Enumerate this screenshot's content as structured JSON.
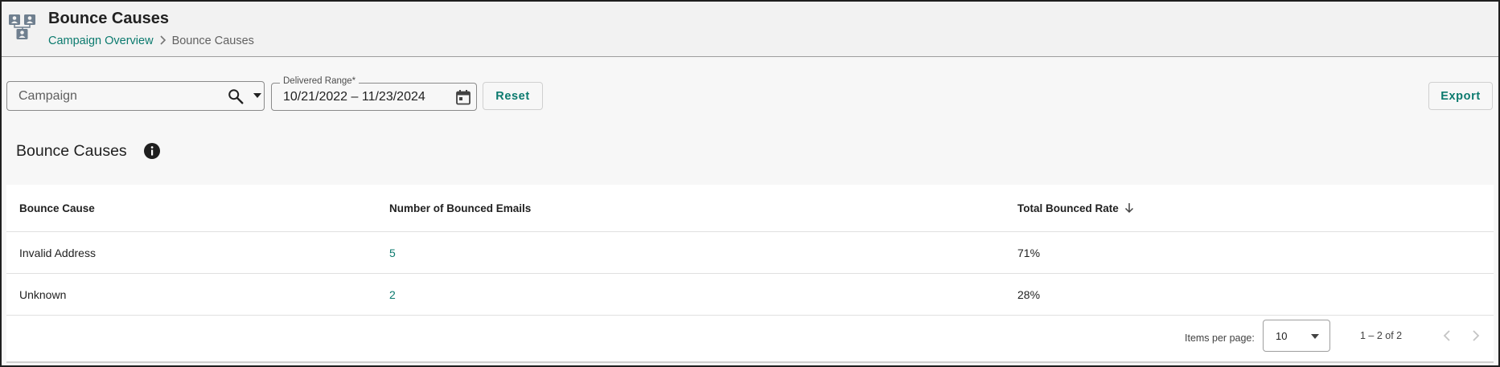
{
  "header": {
    "title": "Bounce Causes",
    "icon": "contacts-group-icon",
    "breadcrumb": {
      "link_label": "Campaign Overview",
      "separator": ">",
      "current": "Bounce Causes"
    }
  },
  "filters": {
    "campaign": {
      "placeholder": "Campaign",
      "value": ""
    },
    "delivered_range": {
      "label": "Delivered Range*",
      "value": "10/21/2022 – 11/23/2024"
    },
    "reset_label": "Reset",
    "export_label": "Export"
  },
  "section": {
    "title": "Bounce Causes",
    "info_icon": "info-icon"
  },
  "table": {
    "columns": [
      "Bounce Cause",
      "Number of Bounced Emails",
      "Total Bounced Rate"
    ],
    "sort": {
      "column": "Total Bounced Rate",
      "direction": "descending"
    },
    "rows": [
      [
        "Invalid Address",
        "5",
        "71%"
      ],
      [
        "Unknown",
        "2",
        "28%"
      ]
    ]
  },
  "pagination": {
    "items_per_page_label": "Items per page:",
    "items_per_page": "10",
    "range_label": "1 – 2 of 2",
    "prev_enabled": false,
    "next_enabled": false
  },
  "colors": {
    "accent": "#0b7a6e",
    "header_bg": "#f2f2f2",
    "page_bg": "#f7f7f7",
    "text": "#212121"
  }
}
